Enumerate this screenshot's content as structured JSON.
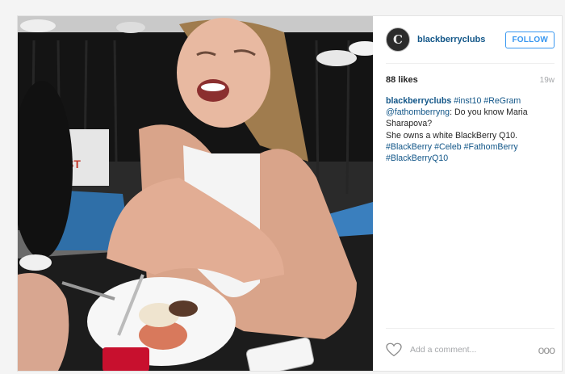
{
  "post": {
    "username": "blackberryclubs",
    "avatar_letter": "C",
    "follow_label": "FOLLOW",
    "likes": "88 likes",
    "time": "19w",
    "caption": {
      "user": "blackberryclubs",
      "tag1": "#inst10",
      "tag2": "#ReGram",
      "mention": "@fathomberryng",
      "line1_rest": ": Do you know Maria Sharapova?",
      "line2": "She owns a white BlackBerry Q10.",
      "tag3": "#BlackBerry",
      "tag4": "#Celeb",
      "tag5": "#FathomBerry",
      "tag6": "#BlackBerryQ10"
    },
    "comment_placeholder": "Add a comment...",
    "more_label": "ooo",
    "photo_sign": "ST"
  },
  "colors": {
    "link": "#125688",
    "follow_blue": "#3897f0",
    "muted": "#a5a7aa"
  },
  "icons": [
    "heart-icon",
    "more-options-icon"
  ]
}
